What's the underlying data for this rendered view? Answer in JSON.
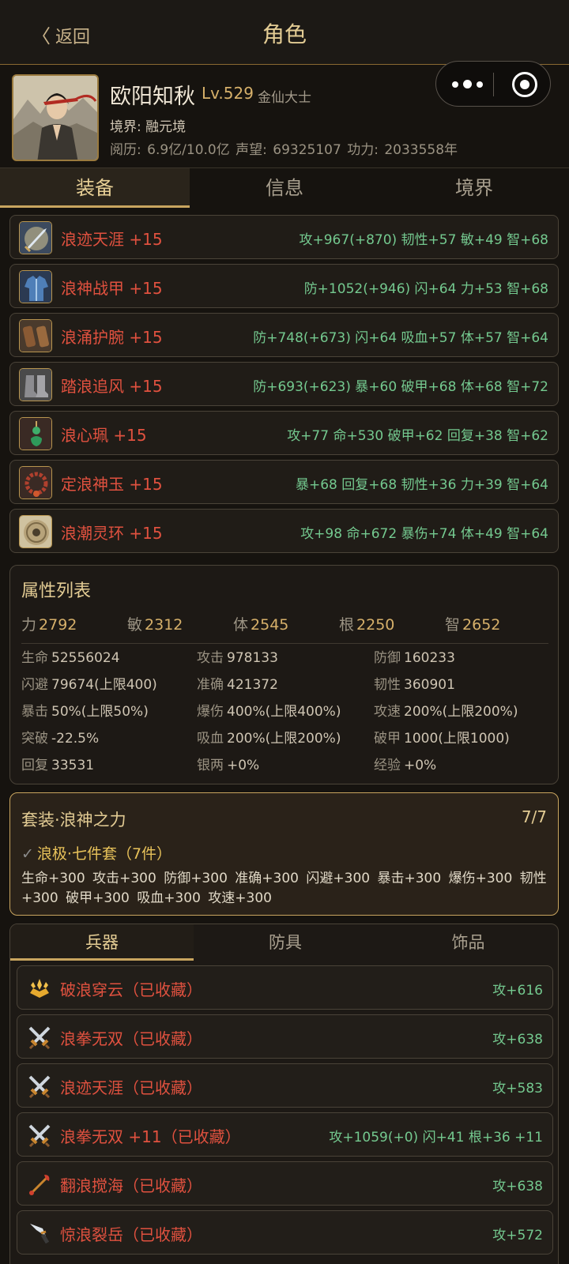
{
  "header": {
    "back_label": "返回",
    "title": "角色"
  },
  "profile": {
    "name": "欧阳知秋",
    "level": "Lv.529",
    "rank": "金仙大士",
    "realm": "境界: 融元境",
    "stats": "阅历: 6.9亿/10.0亿   声望: 69325107   功力: 2033558年"
  },
  "main_tabs": [
    {
      "label": "装备"
    },
    {
      "label": "信息"
    },
    {
      "label": "境界"
    }
  ],
  "equipment": [
    {
      "name": "浪迹天涯 +15",
      "stats": "攻+967(+870) 韧性+57 敏+49 智+68",
      "icon": "glowing-sword-icon"
    },
    {
      "name": "浪神战甲 +15",
      "stats": "防+1052(+946) 闪+64 力+53 智+68",
      "icon": "armor-robe-icon"
    },
    {
      "name": "浪涌护腕 +15",
      "stats": "防+748(+673) 闪+64 吸血+57 体+57 智+64",
      "icon": "bracers-icon"
    },
    {
      "name": "踏浪追风 +15",
      "stats": "防+693(+623) 暴+60 破甲+68 体+68 智+72",
      "icon": "boots-icon"
    },
    {
      "name": "浪心珮 +15",
      "stats": "攻+77 命+530 破甲+62 回复+38 智+62",
      "icon": "jade-pendant-icon"
    },
    {
      "name": "定浪神玉 +15",
      "stats": "暴+68 回复+68 韧性+36 力+39 智+64",
      "icon": "bead-bracelet-icon"
    },
    {
      "name": "浪潮灵环 +15",
      "stats": "攻+98 命+672 暴伤+74 体+49 智+64",
      "icon": "jade-disc-icon"
    }
  ],
  "attributes": {
    "title": "属性列表",
    "base": [
      {
        "k": "力",
        "v": "2792"
      },
      {
        "k": "敏",
        "v": "2312"
      },
      {
        "k": "体",
        "v": "2545"
      },
      {
        "k": "根",
        "v": "2250"
      },
      {
        "k": "智",
        "v": "2652"
      }
    ],
    "details": [
      {
        "k": "生命",
        "v": "52556024"
      },
      {
        "k": "攻击",
        "v": "978133"
      },
      {
        "k": "防御",
        "v": "160233"
      },
      {
        "k": "闪避",
        "v": "79674(上限400)"
      },
      {
        "k": "准确",
        "v": "421372"
      },
      {
        "k": "韧性",
        "v": "360901"
      },
      {
        "k": "暴击",
        "v": "50%(上限50%)"
      },
      {
        "k": "爆伤",
        "v": "400%(上限400%)"
      },
      {
        "k": "攻速",
        "v": "200%(上限200%)"
      },
      {
        "k": "突破",
        "v": "-22.5%"
      },
      {
        "k": "吸血",
        "v": "200%(上限200%)"
      },
      {
        "k": "破甲",
        "v": "1000(上限1000)"
      },
      {
        "k": "回复",
        "v": "33531"
      },
      {
        "k": "银两",
        "v": "+0%"
      },
      {
        "k": "经验",
        "v": "+0%"
      }
    ]
  },
  "set_bonus": {
    "title": "套装·浪神之力",
    "count": "7/7",
    "check_icon": "✓",
    "subtitle": "浪极·七件套（7件）",
    "bonus": "生命+300 攻击+300 防御+300 准确+300 闪避+300 暴击+300 爆伤+300 韧性+300 破甲+300 吸血+300 攻速+300"
  },
  "collection": {
    "tabs": [
      {
        "label": "兵器"
      },
      {
        "label": "防具"
      },
      {
        "label": "饰品"
      }
    ],
    "items": [
      {
        "name": "破浪穿云（已收藏）",
        "stats": "攻+616",
        "icon": "golden-crown-icon"
      },
      {
        "name": "浪拳无双（已收藏）",
        "stats": "攻+638",
        "icon": "crossed-swords-icon"
      },
      {
        "name": "浪迹天涯（已收藏）",
        "stats": "攻+583",
        "icon": "crossed-swords-icon"
      },
      {
        "name": "浪拳无双 +11（已收藏）",
        "stats": "攻+1059(+0) 闪+41 根+36 +11",
        "icon": "crossed-swords-icon"
      },
      {
        "name": "翻浪搅海（已收藏）",
        "stats": "攻+638",
        "icon": "red-staff-icon"
      },
      {
        "name": "惊浪裂岳（已收藏）",
        "stats": "攻+572",
        "icon": "dagger-icon"
      }
    ]
  },
  "colors": {
    "accent_gold": "#c9a55f",
    "equip_name_red": "#e0513f",
    "stat_green": "#74c98f",
    "background": "#16130f"
  }
}
